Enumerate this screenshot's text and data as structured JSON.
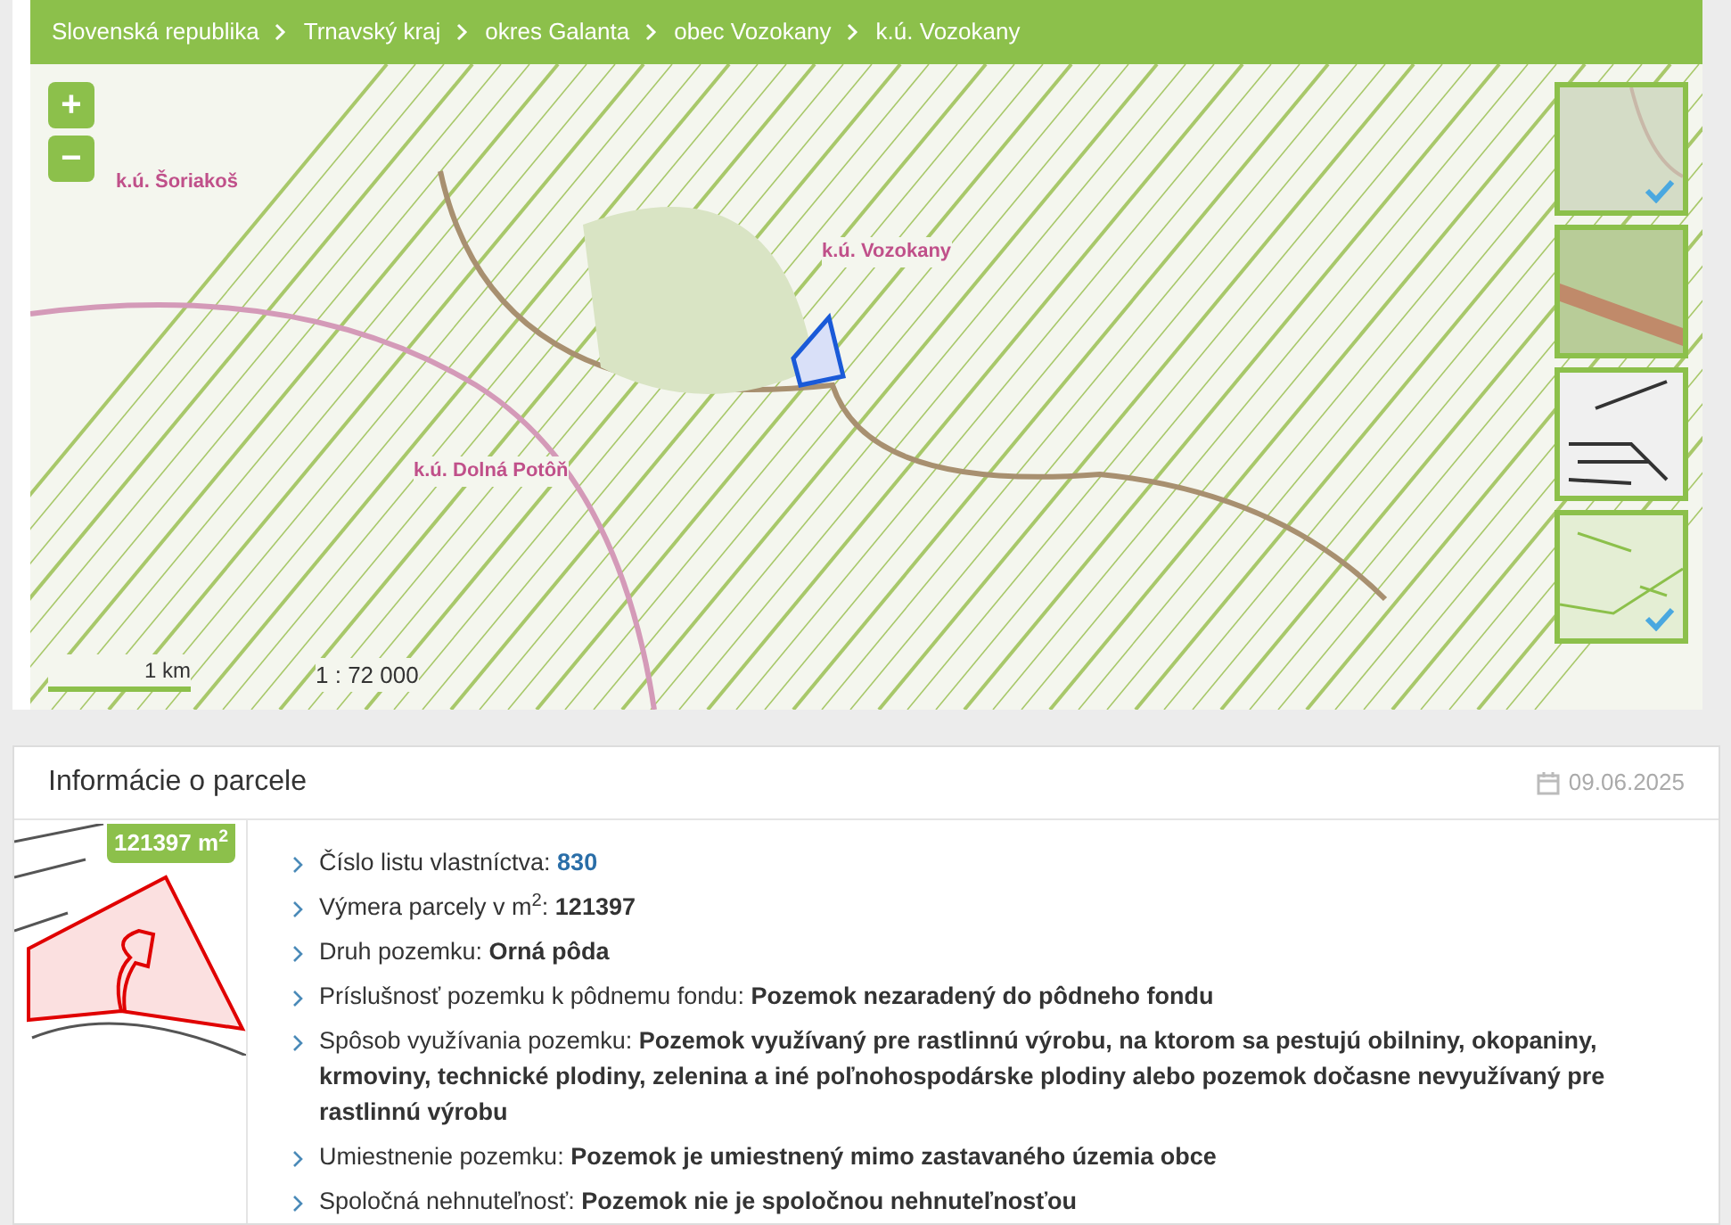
{
  "breadcrumb": [
    "Slovenská republika",
    "Trnavský kraj",
    "okres Galanta",
    "obec Vozokany",
    "k.ú. Vozokany"
  ],
  "map": {
    "zoom_in": "+",
    "zoom_out": "−",
    "labels": [
      {
        "text": "k.ú. Šoriakoš",
        "kind": "area"
      },
      {
        "text": "k.ú. Vozokany",
        "kind": "area"
      },
      {
        "text": "k.ú. Dolná Potôň",
        "kind": "area"
      }
    ],
    "scale_label": "1 km",
    "scale_ratio": "1 : 72 000",
    "layers": [
      {
        "kind": "orto",
        "checked": true
      },
      {
        "kind": "topo",
        "checked": false
      },
      {
        "kind": "kataster",
        "checked": false
      },
      {
        "kind": "parcels",
        "checked": true
      }
    ]
  },
  "parcel_info": {
    "title": "Informácie o parcele",
    "date": "09.06.2025",
    "area_badge": "121397 m$^{2}$",
    "items": [
      {
        "label": "Číslo listu vlastníctva: ",
        "value": "830",
        "kind": "link"
      },
      {
        "text": "Výmera parcely v m$^{2}$: **121397**",
        "kind": "text"
      },
      {
        "text": "Druh pozemku: **Orná pôda**",
        "kind": "text"
      },
      {
        "text": "Príslušnosť pozemku k pôdnemu fondu: **Pozemok nezaradený do pôdneho fondu**",
        "kind": "text"
      },
      {
        "text": "Spôsob využívania pozemku: **Pozemok využívaný pre rastlinnú výrobu, na ktorom sa pestujú obilniny, okopaniny, krmoviny, technické plodiny, zelenina a iné poľnohospodárske plodiny alebo pozemok dočasne nevyužívaný pre rastlinnú výrobu**",
        "kind": "text"
      },
      {
        "text": "Umiestnenie pozemku: **Pozemok je umiestnený mimo zastavaného územia obce**",
        "kind": "text"
      },
      {
        "text": "Spoločná nehnuteľnosť: **Pozemok nie je spoločnou nehnuteľnosťou**",
        "kind": "text"
      }
    ]
  }
}
